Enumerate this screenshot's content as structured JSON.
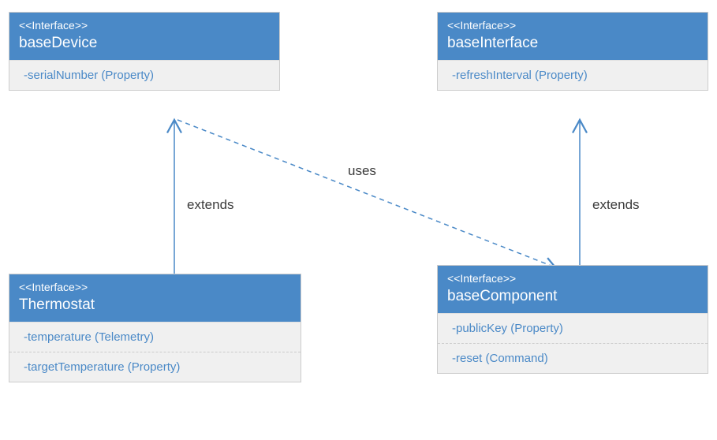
{
  "boxes": {
    "baseDevice": {
      "stereotype": "<<Interface>>",
      "name": "baseDevice",
      "rows": [
        "-serialNumber (Property)"
      ]
    },
    "baseInterface": {
      "stereotype": "<<Interface>>",
      "name": "baseInterface",
      "rows": [
        "-refreshInterval (Property)"
      ]
    },
    "thermostat": {
      "stereotype": "<<Interface>>",
      "name": "Thermostat",
      "rows": [
        "-temperature (Telemetry)",
        "-targetTemperature (Property)"
      ]
    },
    "baseComponent": {
      "stereotype": "<<Interface>>",
      "name": "baseComponent",
      "rows": [
        "-publicKey (Property)",
        "-reset (Command)"
      ]
    }
  },
  "labels": {
    "extends1": "extends",
    "uses": "uses",
    "extends2": "extends"
  },
  "colors": {
    "headerBlue": "#4a89c7",
    "bodyGray": "#f0f0f0",
    "textBlue": "#4a89c7"
  }
}
